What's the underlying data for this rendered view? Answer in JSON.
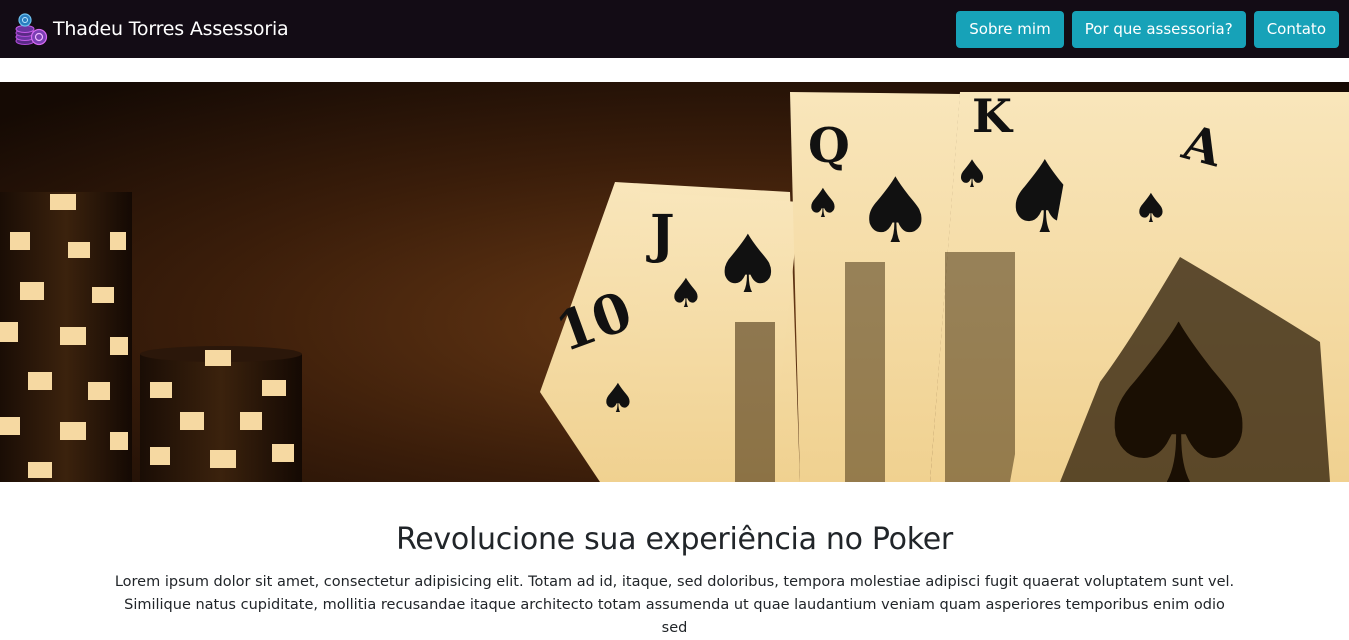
{
  "navbar": {
    "brand": "Thadeu Torres Assessoria",
    "logo_icon": "poker-chips-icon",
    "buttons": [
      {
        "label": "Sobre mim"
      },
      {
        "label": "Por que assessoria?"
      },
      {
        "label": "Contato"
      }
    ],
    "colors": {
      "background": "#130c15",
      "button": "#17a2b8"
    }
  },
  "hero": {
    "image": "poker-chips-and-royal-flush-cards"
  },
  "main": {
    "headline": "Revolucione sua experiência no Poker",
    "paragraph": "Lorem ipsum dolor sit amet, consectetur adipisicing elit. Totam ad id, itaque, sed doloribus, tempora molestiae adipisci fugit quaerat voluptatem sunt vel. Similique natus cupiditate, mollitia recusandae itaque architecto totam assumenda ut quae laudantium veniam quam asperiores temporibus enim odio sed"
  }
}
